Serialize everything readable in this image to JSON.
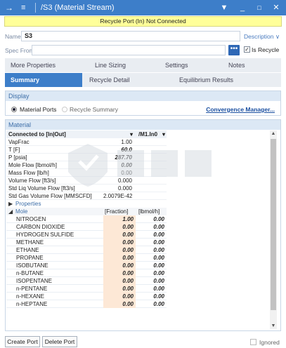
{
  "window": {
    "title": "/S3 (Material Stream)",
    "controls": [
      "pin-icon",
      "minimize-icon",
      "maximize-icon",
      "close-icon"
    ]
  },
  "banner": "Recycle Port (In) Not Connected",
  "name": {
    "label": "Name",
    "value": "S3",
    "description_link": "Description ∨"
  },
  "spec_from": {
    "label": "Spec From",
    "value": "",
    "button": "•••",
    "is_recycle_label": "Is Recycle",
    "is_recycle_checked": true
  },
  "tabs_top": [
    "More Properties",
    "Line Sizing",
    "Settings",
    "Notes"
  ],
  "tabs_bottom": [
    {
      "label": "Summary",
      "active": true
    },
    {
      "label": "Recycle Detail",
      "active": false
    },
    {
      "label": "Equilibrium Results",
      "active": false
    }
  ],
  "display": {
    "header": "Display",
    "option_material": "Material Ports",
    "option_recycle": "Recycle Summary",
    "convergence_link": "Convergence Manager..."
  },
  "material": {
    "header": "Material",
    "connected_label": "Connected to [In|Out]",
    "connected_out": "/M1.In0",
    "properties": [
      {
        "name": "VapFrac",
        "value": "1.00",
        "style": "plain"
      },
      {
        "name": "T [F]",
        "value": "60.0",
        "style": "bold"
      },
      {
        "name": "P [psia]",
        "value": "287.70",
        "style": "bold"
      },
      {
        "name": "Mole Flow [lbmol/h]",
        "value": "0.00",
        "style": "bold"
      },
      {
        "name": "Mass Flow [lb/h]",
        "value": "0.00",
        "style": "plain"
      },
      {
        "name": "Volume Flow [ft3/s]",
        "value": "0.000",
        "style": "plain"
      },
      {
        "name": "Std Liq Volume Flow [ft3/s]",
        "value": "0.000",
        "style": "plain"
      },
      {
        "name": "Std Gas Volume Flow [MMSCFD]",
        "value": "2.0079E-42",
        "style": "plain"
      }
    ],
    "properties_group": "Properties",
    "mole_group": "Mole",
    "col_fraction": "[Fraction]",
    "col_lbmol": "[lbmol/h]",
    "components": [
      {
        "name": "NITROGEN",
        "fraction": "1.00",
        "flow": "0.00"
      },
      {
        "name": "CARBON DIOXIDE",
        "fraction": "0.00",
        "flow": "0.00"
      },
      {
        "name": "HYDROGEN SULFIDE",
        "fraction": "0.00",
        "flow": "0.00"
      },
      {
        "name": "METHANE",
        "fraction": "0.00",
        "flow": "0.00"
      },
      {
        "name": "ETHANE",
        "fraction": "0.00",
        "flow": "0.00"
      },
      {
        "name": "PROPANE",
        "fraction": "0.00",
        "flow": "0.00"
      },
      {
        "name": "ISOBUTANE",
        "fraction": "0.00",
        "flow": "0.00"
      },
      {
        "name": "n-BUTANE",
        "fraction": "0.00",
        "flow": "0.00"
      },
      {
        "name": "ISOPENTANE",
        "fraction": "0.00",
        "flow": "0.00"
      },
      {
        "name": "n-PENTANE",
        "fraction": "0.00",
        "flow": "0.00"
      },
      {
        "name": "n-HEXANE",
        "fraction": "0.00",
        "flow": "0.00"
      },
      {
        "name": "n-HEPTANE",
        "fraction": "0.00",
        "flow": "0.00"
      }
    ]
  },
  "footer": {
    "create_port": "Create Port",
    "delete_port": "Delete Port",
    "ignored_label": "Ignored",
    "ignored_checked": false
  },
  "colors": {
    "accent": "#3d7ec9",
    "banner": "#ffff99",
    "editable_cell": "#fde8d6"
  }
}
